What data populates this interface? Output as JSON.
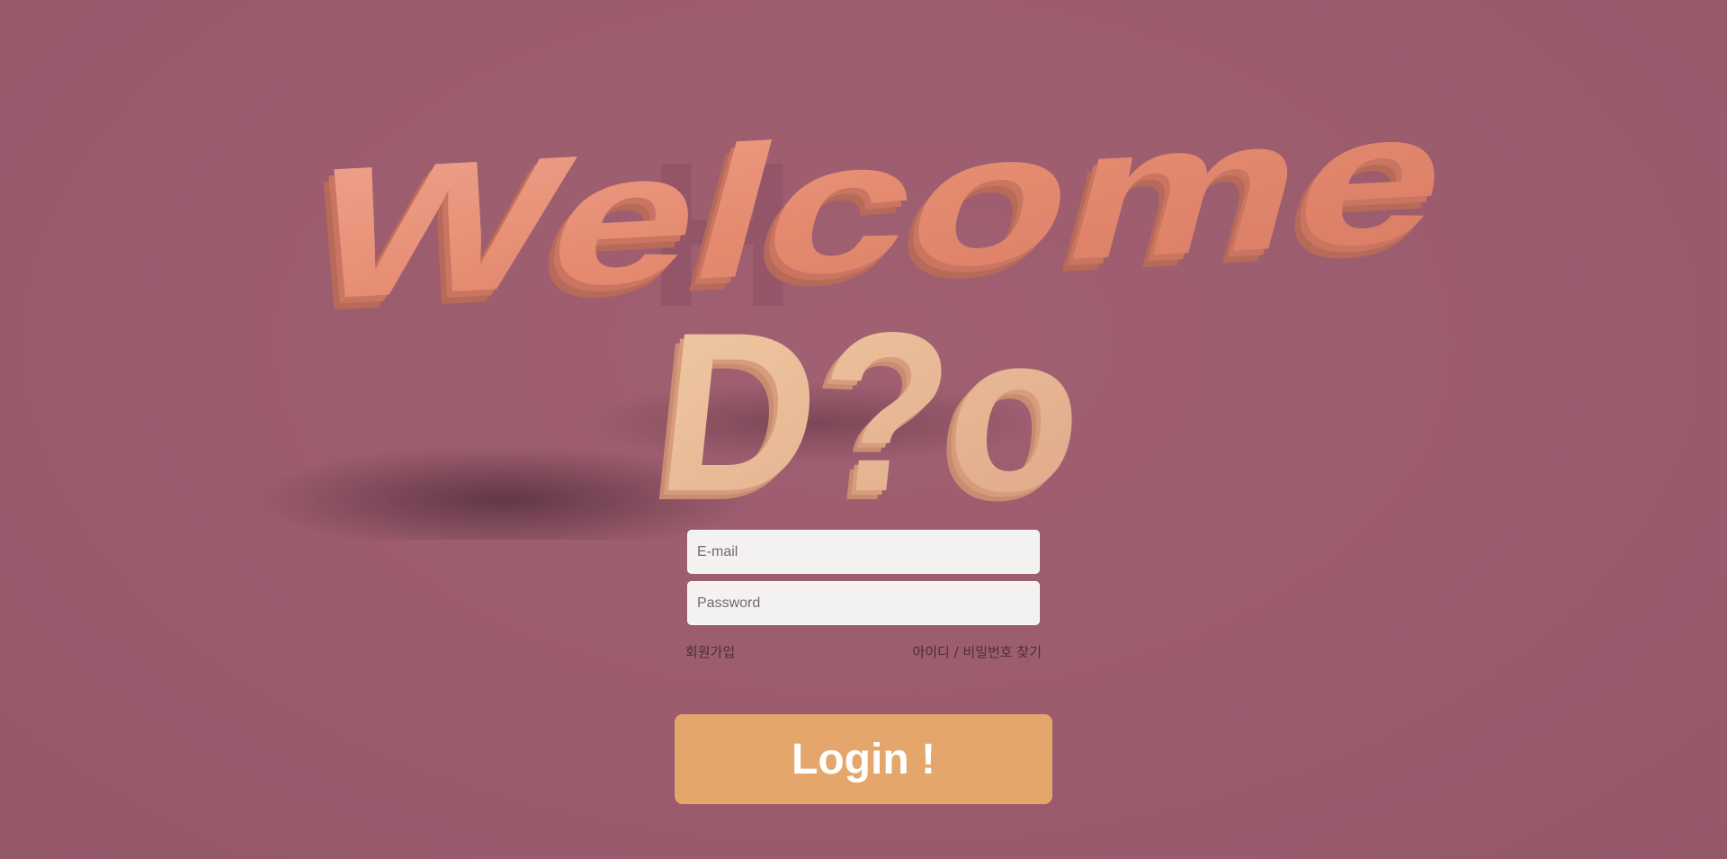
{
  "hero": {
    "headline_word1": "Welcome",
    "headline_word2": "D?o",
    "accent_color": "#e08a6c",
    "secondary_color": "#e8b892"
  },
  "form": {
    "email": {
      "placeholder": "E-mail",
      "value": ""
    },
    "password": {
      "placeholder": "Password",
      "value": ""
    }
  },
  "links": {
    "signup": "회원가입",
    "find_account": "아이디 / 비밀번호 찾기"
  },
  "login_button": {
    "label": "Login !",
    "color": "#e4a66a"
  },
  "colors": {
    "background": "#9b5c6e",
    "field_background": "#f4f1f1",
    "link_text": "#4a2f38"
  }
}
